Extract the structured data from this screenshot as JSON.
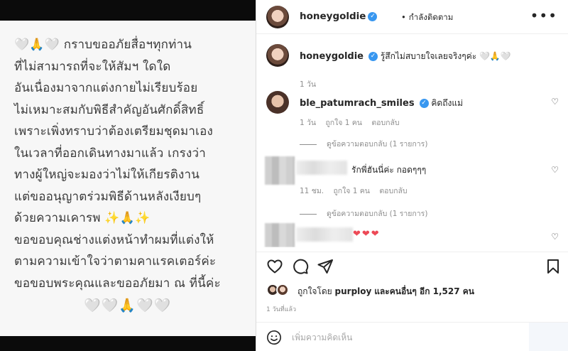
{
  "image_caption": {
    "lines": [
      "🤍🙏🤍 กราบขออภัยสื่อฯทุกท่าน",
      "ที่ไม่สามารถที่จะให้สัมฯ ใดใด",
      "อันเนื่องมาจากแต่งกายไม่เรียบร้อย",
      "ไม่เหมาะสมกับพิธีสำคัญอันศักดิ์สิทธิ์",
      "เพราะเพิ่งทราบว่าต้องเตรียมชุดมาเอง",
      "ในเวลาที่ออกเดินทางมาแล้ว เกรงว่า",
      "ทางผู้ใหญ่จะมองว่าไม่ให้เกียรติงาน",
      "แต่ขออนุญาตร่วมพิธีด้านหลังเงียบๆ",
      "ด้วยความเคารพ ✨🙏✨",
      "ขอขอบคุณช่างแต่งหน้าทำผมที่แต่งให้",
      "ตามความเข้าใจว่าตามคาแรคเตอร์ค่ะ",
      "ขอขอบพระคุณและขออภัยมา ณ ที่นี้ค่ะ"
    ],
    "closing": "🤍🤍🙏🤍🤍"
  },
  "header": {
    "username": "honeygoldie",
    "verified_icon": "check",
    "dot": "•",
    "follow_status": "กำลังติดตาม",
    "more_icon": "•••"
  },
  "caption_comment": {
    "username": "honeygoldie",
    "text": "รู้สึกไม่สบายใจเลยจริงๆค่ะ 🤍🙏🤍",
    "time": "1 วัน"
  },
  "comments": [
    {
      "username": "ble_patumrach_smiles",
      "text": "คิดถึงแม่",
      "time": "1 วัน",
      "likes": "ถูกใจ 1 คน",
      "reply": "ตอบกลับ",
      "view_replies": "ดูข้อความตอบกลับ (1 รายการ)"
    },
    {
      "username": "",
      "text": "รักพี่ฮันนี่ค่ะ กอดๆๆๆ",
      "time": "11 ชม.",
      "likes": "ถูกใจ 1 คน",
      "reply": "ตอบกลับ",
      "view_replies": "ดูข้อความตอบกลับ (1 รายการ)"
    },
    {
      "username": "",
      "text": "❤❤❤"
    }
  ],
  "likes": {
    "prefix": "ถูกใจโดย",
    "user": "purploy",
    "middle": "และ",
    "others": "คนอื่นๆ อีก 1,527 คน"
  },
  "time_ago": "1 วันที่แล้ว",
  "add_comment": {
    "placeholder": "เพิ่มความคิดเห็น"
  },
  "colors": {
    "verified": "#3897f0",
    "heart_red": "#ed4956",
    "text": "#262626",
    "muted": "#8e8e8e"
  }
}
